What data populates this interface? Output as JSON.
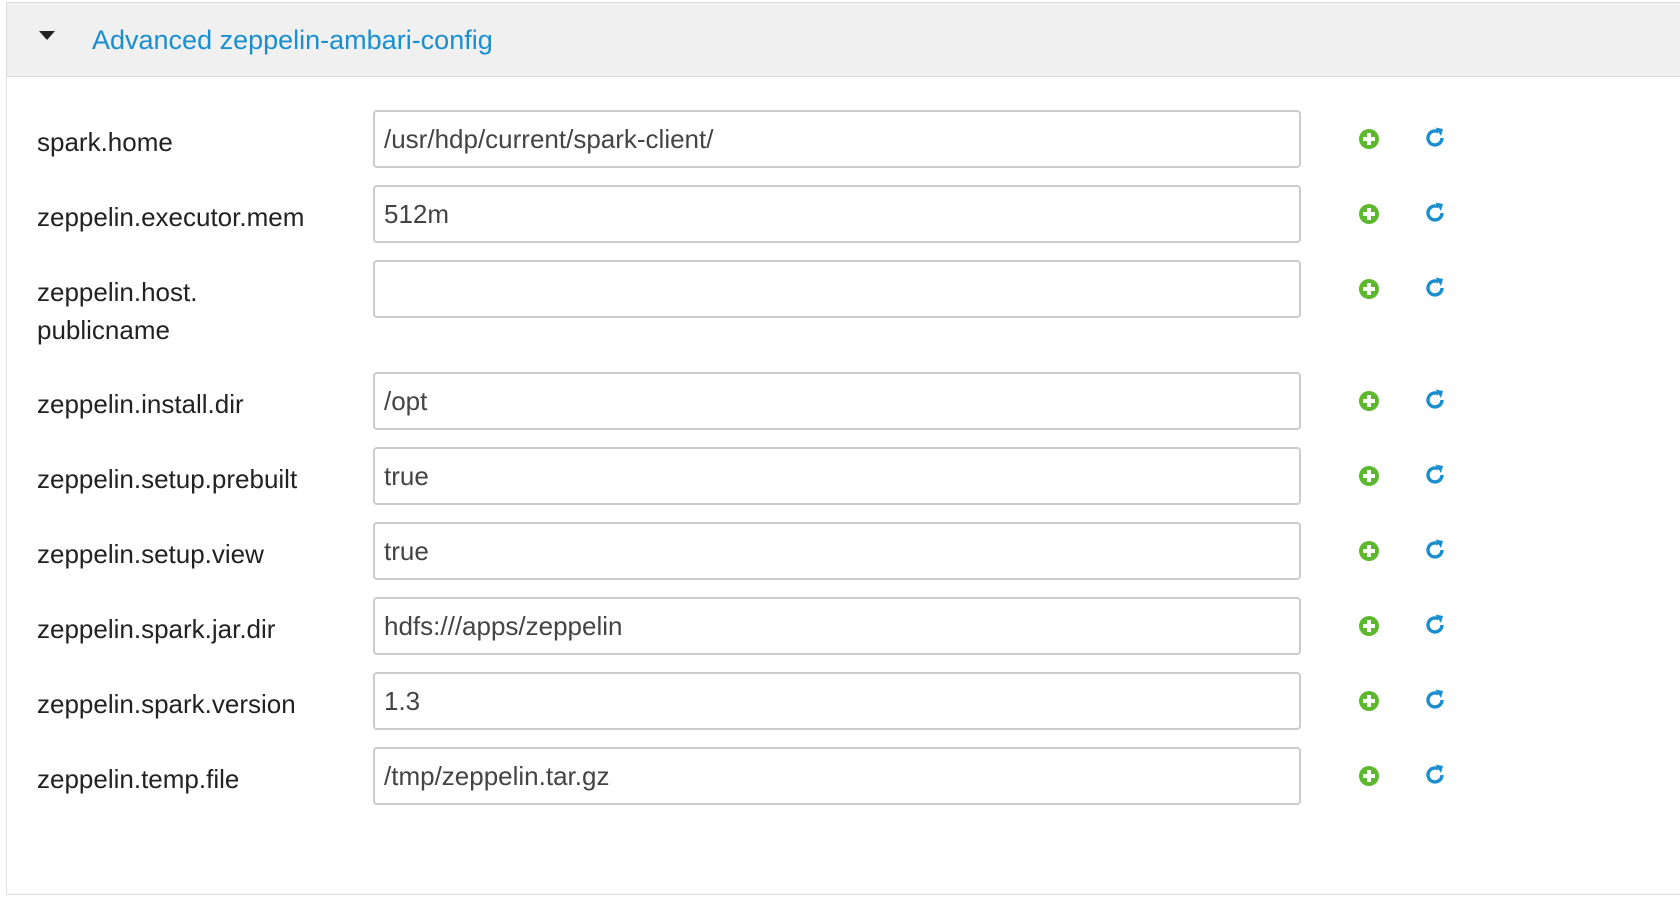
{
  "section": {
    "title": "Advanced zeppelin-ambari-config",
    "expanded": true
  },
  "colors": {
    "accent": "#1a8fcf",
    "add_icon": "#5cb82c",
    "undo_icon": "#1a8fcf",
    "header_bg": "#f0f0f0"
  },
  "icons": {
    "toggle": "caret-down-icon",
    "add": "plus-circle-icon",
    "undo": "refresh-icon"
  },
  "properties": [
    {
      "name": "spark.home",
      "value": "/usr/hdp/current/spark-client/"
    },
    {
      "name": "zeppelin.executor.mem",
      "value": "512m"
    },
    {
      "name": "zeppelin.host.\npublicname",
      "value": ""
    },
    {
      "name": "zeppelin.install.dir",
      "value": "/opt"
    },
    {
      "name": "zeppelin.setup.prebuilt",
      "value": "true"
    },
    {
      "name": "zeppelin.setup.view",
      "value": "true"
    },
    {
      "name": "zeppelin.spark.jar.dir",
      "value": "hdfs:///apps/zeppelin"
    },
    {
      "name": "zeppelin.spark.version",
      "value": "1.3"
    },
    {
      "name": "zeppelin.temp.file",
      "value": "/tmp/zeppelin.tar.gz"
    }
  ]
}
